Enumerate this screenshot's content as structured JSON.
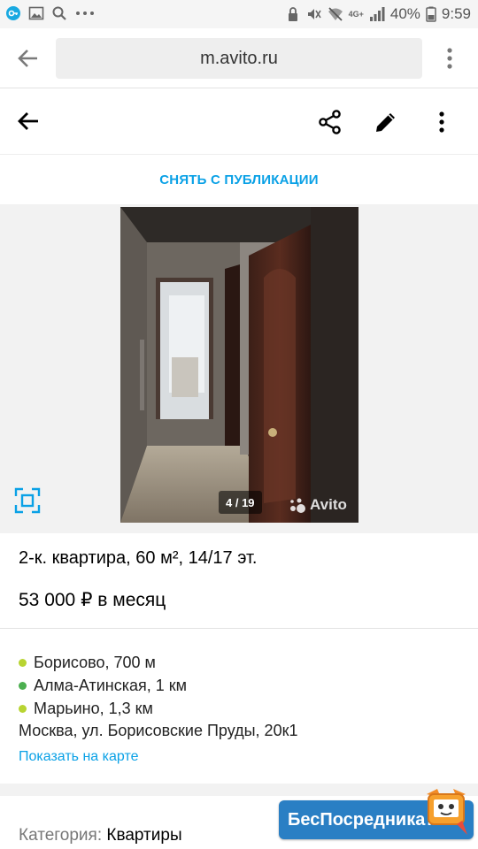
{
  "status_bar": {
    "battery": "40%",
    "time": "9:59",
    "network": "4G+"
  },
  "browser": {
    "url": "m.avito.ru"
  },
  "toolbar": {
    "unpublish_label": "СНЯТЬ С ПУБЛИКАЦИИ"
  },
  "gallery": {
    "counter": "4 / 19",
    "watermark": "Avito"
  },
  "listing": {
    "title": "2-к. квартира, 60 м², 14/17 эт.",
    "price": "53 000 ₽ в месяц",
    "metro": [
      {
        "name": "Борисово, 700 м",
        "color": "#b8d432"
      },
      {
        "name": "Алма-Атинская, 1 км",
        "color": "#4caf50"
      },
      {
        "name": "Марьино, 1,3 км",
        "color": "#b8d432"
      }
    ],
    "address": "Москва, ул. Борисовские Пруды, 20к1",
    "map_link": "Показать на карте",
    "category_label": "Категория:",
    "category_value": "Квартиры"
  },
  "overlay_badge": {
    "text": "БесПосредника",
    "suffix": ".ru"
  },
  "colors": {
    "accent": "#0AA1E6"
  }
}
